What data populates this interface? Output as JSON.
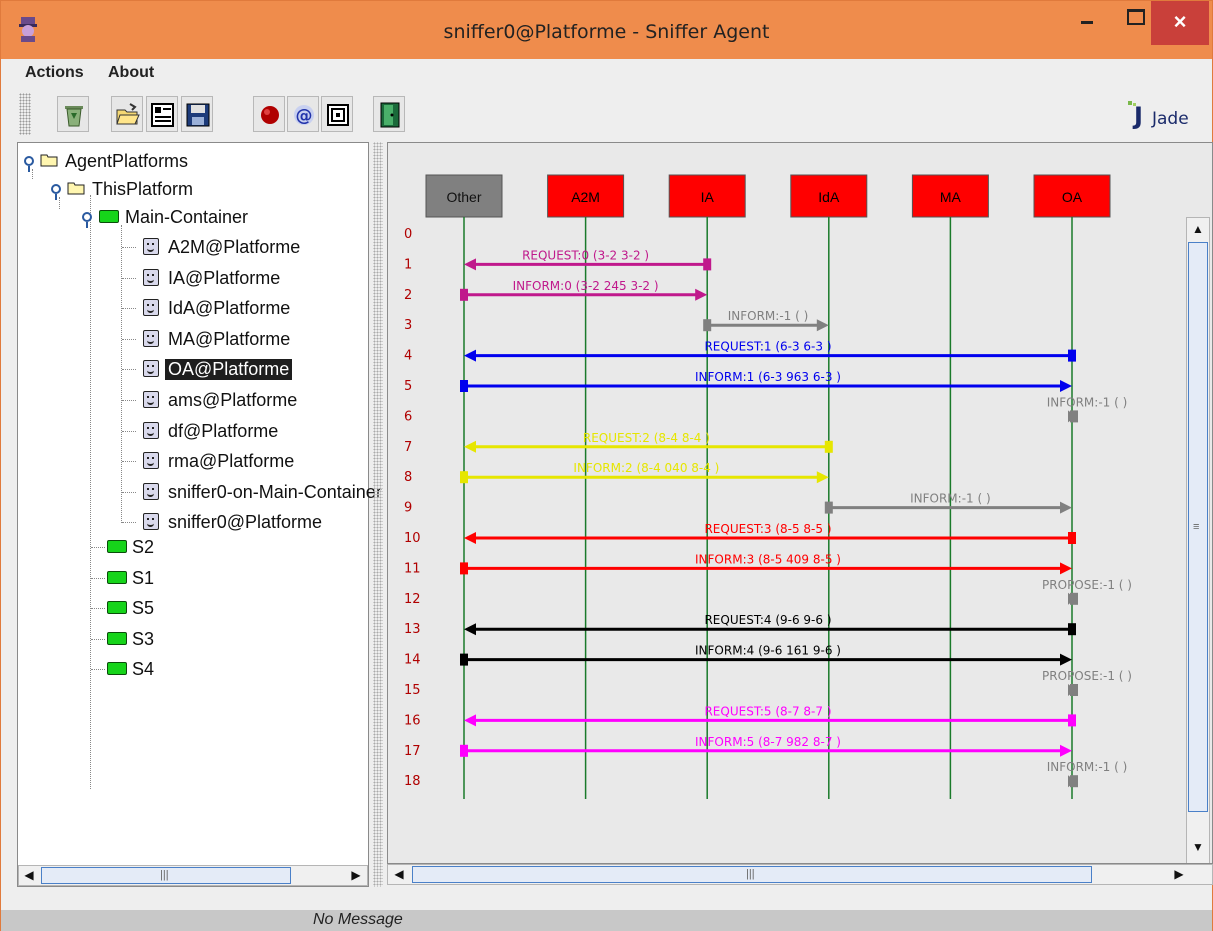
{
  "window": {
    "title": "sniffer0@Platforme - Sniffer Agent",
    "close_glyph": "×"
  },
  "menubar": {
    "items": [
      {
        "label": "Actions"
      },
      {
        "label": "About"
      }
    ]
  },
  "toolbar": {
    "buttons": [
      {
        "icon": "trash-icon"
      },
      {
        "icon": "open-folder-icon"
      },
      {
        "icon": "document-icon"
      },
      {
        "icon": "save-icon"
      },
      {
        "icon": "record-icon"
      },
      {
        "icon": "at-icon"
      },
      {
        "icon": "target-icon"
      },
      {
        "icon": "exit-door-icon"
      }
    ],
    "logo_text": "Jade"
  },
  "tree": {
    "root": "AgentPlatforms",
    "platform": "ThisPlatform",
    "main_container": "Main-Container",
    "agents": [
      "A2M@Platforme",
      "IA@Platforme",
      "IdA@Platforme",
      "MA@Platforme",
      "OA@Platforme",
      "ams@Platforme",
      "df@Platforme",
      "rma@Platforme",
      "sniffer0-on-Main-Container",
      "sniffer0@Platforme"
    ],
    "selected_agent": "OA@Platforme",
    "containers": [
      "S2",
      "S1",
      "S5",
      "S3",
      "S4"
    ],
    "scroll_grip": "|||"
  },
  "diagram": {
    "agents": [
      {
        "name": "Other",
        "color": "#808080",
        "text_color": "#111111"
      },
      {
        "name": "A2M",
        "color": "#ff0000",
        "text_color": "#000000"
      },
      {
        "name": "IA",
        "color": "#ff0000",
        "text_color": "#000000"
      },
      {
        "name": "IdA",
        "color": "#ff0000",
        "text_color": "#000000"
      },
      {
        "name": "MA",
        "color": "#ff0000",
        "text_color": "#000000"
      },
      {
        "name": "OA",
        "color": "#ff0000",
        "text_color": "#000000"
      }
    ],
    "row_numbers": [
      "0",
      "1",
      "2",
      "3",
      "4",
      "5",
      "6",
      "7",
      "8",
      "9",
      "10",
      "11",
      "12",
      "13",
      "14",
      "15",
      "16",
      "17",
      "18"
    ],
    "messages": [
      {
        "row": 1,
        "from": "IA",
        "to": "Other",
        "label": "REQUEST:0 (3-2  3-2   )",
        "color": "#c0198c"
      },
      {
        "row": 2,
        "from": "Other",
        "to": "IA",
        "label": "INFORM:0 (3-2  245  3-2 )",
        "color": "#c0198c"
      },
      {
        "row": 3,
        "from": "IA",
        "to": "IdA",
        "label": "INFORM:-1 (        )",
        "color": "#808080"
      },
      {
        "row": 4,
        "from": "OA",
        "to": "Other",
        "label": "REQUEST:1 (6-3  6-3    )",
        "color": "#0000ee"
      },
      {
        "row": 5,
        "from": "Other",
        "to": "OA",
        "label": "INFORM:1 (6-3  963  6-3 )",
        "color": "#0000ee"
      },
      {
        "row": 6,
        "from": "OA",
        "to": "OA",
        "label": "INFORM:-1 (        )",
        "color": "#808080"
      },
      {
        "row": 7,
        "from": "IdA",
        "to": "Other",
        "label": "REQUEST:2 (8-4  8-4    )",
        "color": "#e6e600"
      },
      {
        "row": 8,
        "from": "Other",
        "to": "IdA",
        "label": "INFORM:2 (8-4  040  8-4 )",
        "color": "#e6e600"
      },
      {
        "row": 9,
        "from": "IdA",
        "to": "OA",
        "label": "INFORM:-1 (        )",
        "color": "#808080"
      },
      {
        "row": 10,
        "from": "OA",
        "to": "Other",
        "label": "REQUEST:3 (8-5  8-5    )",
        "color": "#ff0000"
      },
      {
        "row": 11,
        "from": "Other",
        "to": "OA",
        "label": "INFORM:3 (8-5  409  8-5 )",
        "color": "#ff0000"
      },
      {
        "row": 12,
        "from": "OA",
        "to": "OA",
        "label": "PROPOSE:-1 (        )",
        "color": "#808080"
      },
      {
        "row": 13,
        "from": "OA",
        "to": "Other",
        "label": "REQUEST:4 (9-6  9-6    )",
        "color": "#000000"
      },
      {
        "row": 14,
        "from": "Other",
        "to": "OA",
        "label": "INFORM:4 (9-6  161  9-6 )",
        "color": "#000000"
      },
      {
        "row": 15,
        "from": "OA",
        "to": "OA",
        "label": "PROPOSE:-1 (        )",
        "color": "#808080"
      },
      {
        "row": 16,
        "from": "OA",
        "to": "Other",
        "label": "REQUEST:5 (8-7  8-7    )",
        "color": "#ff00ff"
      },
      {
        "row": 17,
        "from": "Other",
        "to": "OA",
        "label": "INFORM:5 (8-7  982  8-7 )",
        "color": "#ff00ff"
      },
      {
        "row": 18,
        "from": "OA",
        "to": "OA",
        "label": "INFORM:-1 (        )",
        "color": "#808080"
      }
    ],
    "lifeline_color": "#1a7a2a",
    "scroll_grip": "|||",
    "vscroll_grip": "≡"
  },
  "status": {
    "message": "No Message"
  }
}
